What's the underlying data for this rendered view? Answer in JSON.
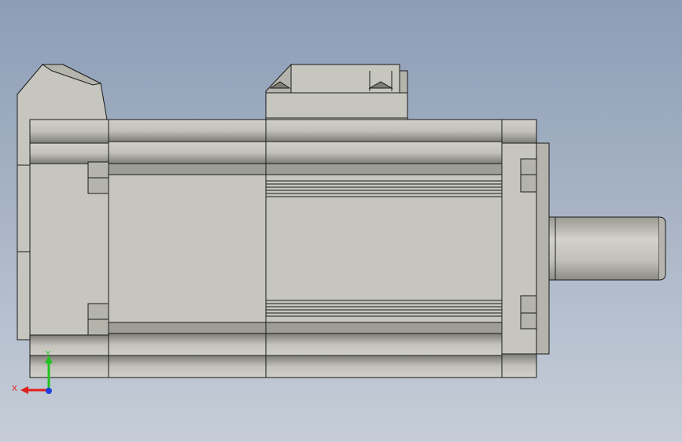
{
  "viewport": {
    "background_top": "#8c9db5",
    "background_bottom": "#c6cdd8"
  },
  "model": {
    "body_color": "#c6c6be",
    "shade_color": "#a9a9a1",
    "dark_shade_color": "#8f8f87",
    "edge_color": "#1a1a1a"
  },
  "triad": {
    "x_label": "X",
    "y_label": "Y",
    "x_color": "#e0201c",
    "y_color": "#1fc21f",
    "z_color": "#1f3fe0"
  }
}
